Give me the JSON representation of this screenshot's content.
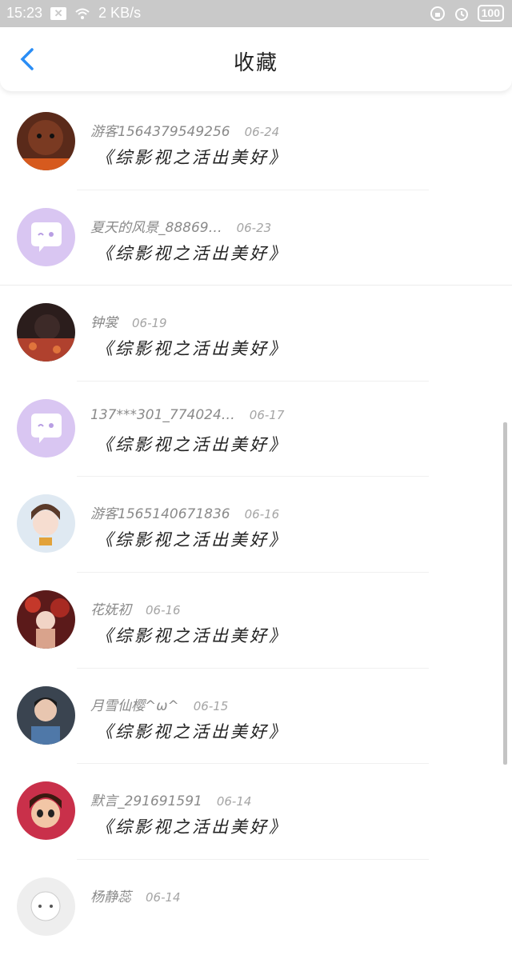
{
  "status_bar": {
    "time": "15:23",
    "speed": "2 KB/s",
    "battery": "100"
  },
  "header": {
    "title": "收藏"
  },
  "items": [
    {
      "name": "游客1564379549256",
      "date": "06-24",
      "book": "《综影视之活出美好》",
      "avatar": "avatar-dog"
    },
    {
      "name": "夏天的风景_88869…",
      "date": "06-23",
      "book": "《综影视之活出美好》",
      "avatar": "avatar-default"
    },
    {
      "name": "钟裳",
      "date": "06-19",
      "book": "《综影视之活出美好》",
      "avatar": "avatar-girl-dark"
    },
    {
      "name": "137***301_774024…",
      "date": "06-17",
      "book": "《综影视之活出美好》",
      "avatar": "avatar-default"
    },
    {
      "name": "游客1565140671836",
      "date": "06-16",
      "book": "《综影视之活出美好》",
      "avatar": "avatar-anime-girl"
    },
    {
      "name": "花妩初",
      "date": "06-16",
      "book": "《综影视之活出美好》",
      "avatar": "avatar-red-art"
    },
    {
      "name": "月雪仙樱^ω^",
      "date": "06-15",
      "book": "《综影视之活出美好》",
      "avatar": "avatar-man"
    },
    {
      "name": "默言_291691591",
      "date": "06-14",
      "book": "《综影视之活出美好》",
      "avatar": "avatar-cartoon"
    },
    {
      "name": "杨静蕊",
      "date": "06-14",
      "book": "",
      "avatar": "avatar-white"
    }
  ]
}
